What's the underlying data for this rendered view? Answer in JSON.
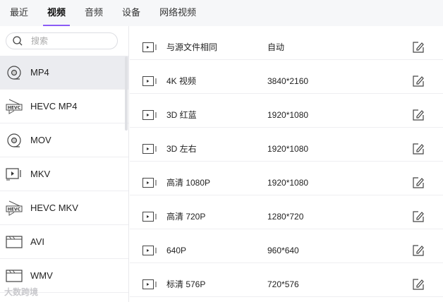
{
  "tabs": [
    {
      "label": "最近"
    },
    {
      "label": "视频",
      "active": true
    },
    {
      "label": "音频"
    },
    {
      "label": "设备"
    },
    {
      "label": "网络视频"
    }
  ],
  "search": {
    "placeholder": "搜索",
    "value": ""
  },
  "formats": [
    {
      "label": "MP4",
      "icon": "disc-icon",
      "selected": true
    },
    {
      "label": "HEVC MP4",
      "icon": "hevc-icon"
    },
    {
      "label": "MOV",
      "icon": "disc-icon"
    },
    {
      "label": "MKV",
      "icon": "video-camera-icon"
    },
    {
      "label": "HEVC MKV",
      "icon": "hevc-icon"
    },
    {
      "label": "AVI",
      "icon": "clapperboard-icon"
    },
    {
      "label": "WMV",
      "icon": "clapperboard-icon"
    }
  ],
  "presets": [
    {
      "name": "与源文件相同",
      "resolution": "自动"
    },
    {
      "name": "4K 视频",
      "resolution": "3840*2160"
    },
    {
      "name": "3D 红蓝",
      "resolution": "1920*1080"
    },
    {
      "name": "3D 左右",
      "resolution": "1920*1080"
    },
    {
      "name": "高清 1080P",
      "resolution": "1920*1080"
    },
    {
      "name": "高清 720P",
      "resolution": "1280*720"
    },
    {
      "name": "640P",
      "resolution": "960*640"
    },
    {
      "name": "标清 576P",
      "resolution": "720*576"
    }
  ],
  "watermark": "大数跨境",
  "colors": {
    "accent": "#8b5cf6",
    "selected_bg": "#ebecf0",
    "tab_bg": "#f6f7f9"
  }
}
